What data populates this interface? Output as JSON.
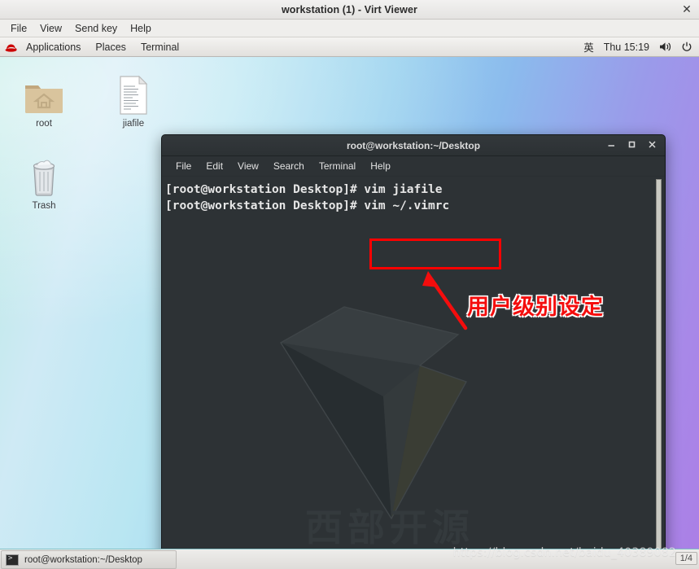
{
  "viewer": {
    "title": "workstation (1) - Virt Viewer",
    "close_label": "✕",
    "menu": [
      "File",
      "View",
      "Send key",
      "Help"
    ]
  },
  "gnome_panel": {
    "logo_icon": "redhat-logo-icon",
    "menu": [
      "Applications",
      "Places",
      "Terminal"
    ],
    "tray": {
      "input_method": "英",
      "clock": "Thu 15:19",
      "volume_icon": "🔊",
      "power_icon": "⏻"
    }
  },
  "desktop": {
    "icons": [
      {
        "name": "root",
        "label": "root",
        "icon": "home-folder-icon"
      },
      {
        "name": "jiafile",
        "label": "jiafile",
        "icon": "document-file-icon"
      },
      {
        "name": "trash",
        "label": "Trash",
        "icon": "trash-can-icon"
      }
    ]
  },
  "terminal": {
    "title": "root@workstation:~/Desktop",
    "buttons": {
      "minimize": "—",
      "maximize": "□",
      "close": "✕"
    },
    "menu": [
      "File",
      "Edit",
      "View",
      "Search",
      "Terminal",
      "Help"
    ],
    "lines": [
      "[root@workstation Desktop]# vim jiafile",
      "[root@workstation Desktop]# vim ~/.vimrc"
    ],
    "watermark_text": "西部开源"
  },
  "annotations": {
    "highlight_box_color": "#fe0000",
    "arrow_color": "#f40d0d",
    "note_text": "用户级别设定",
    "note_color": "#f40d0d"
  },
  "taskbar": {
    "window_item": "root@workstation:~/Desktop",
    "window_icon": "terminal-icon",
    "pages": "1/4"
  },
  "watermark": {
    "url": "https://blog.csdn.net/baidu_40389082"
  }
}
